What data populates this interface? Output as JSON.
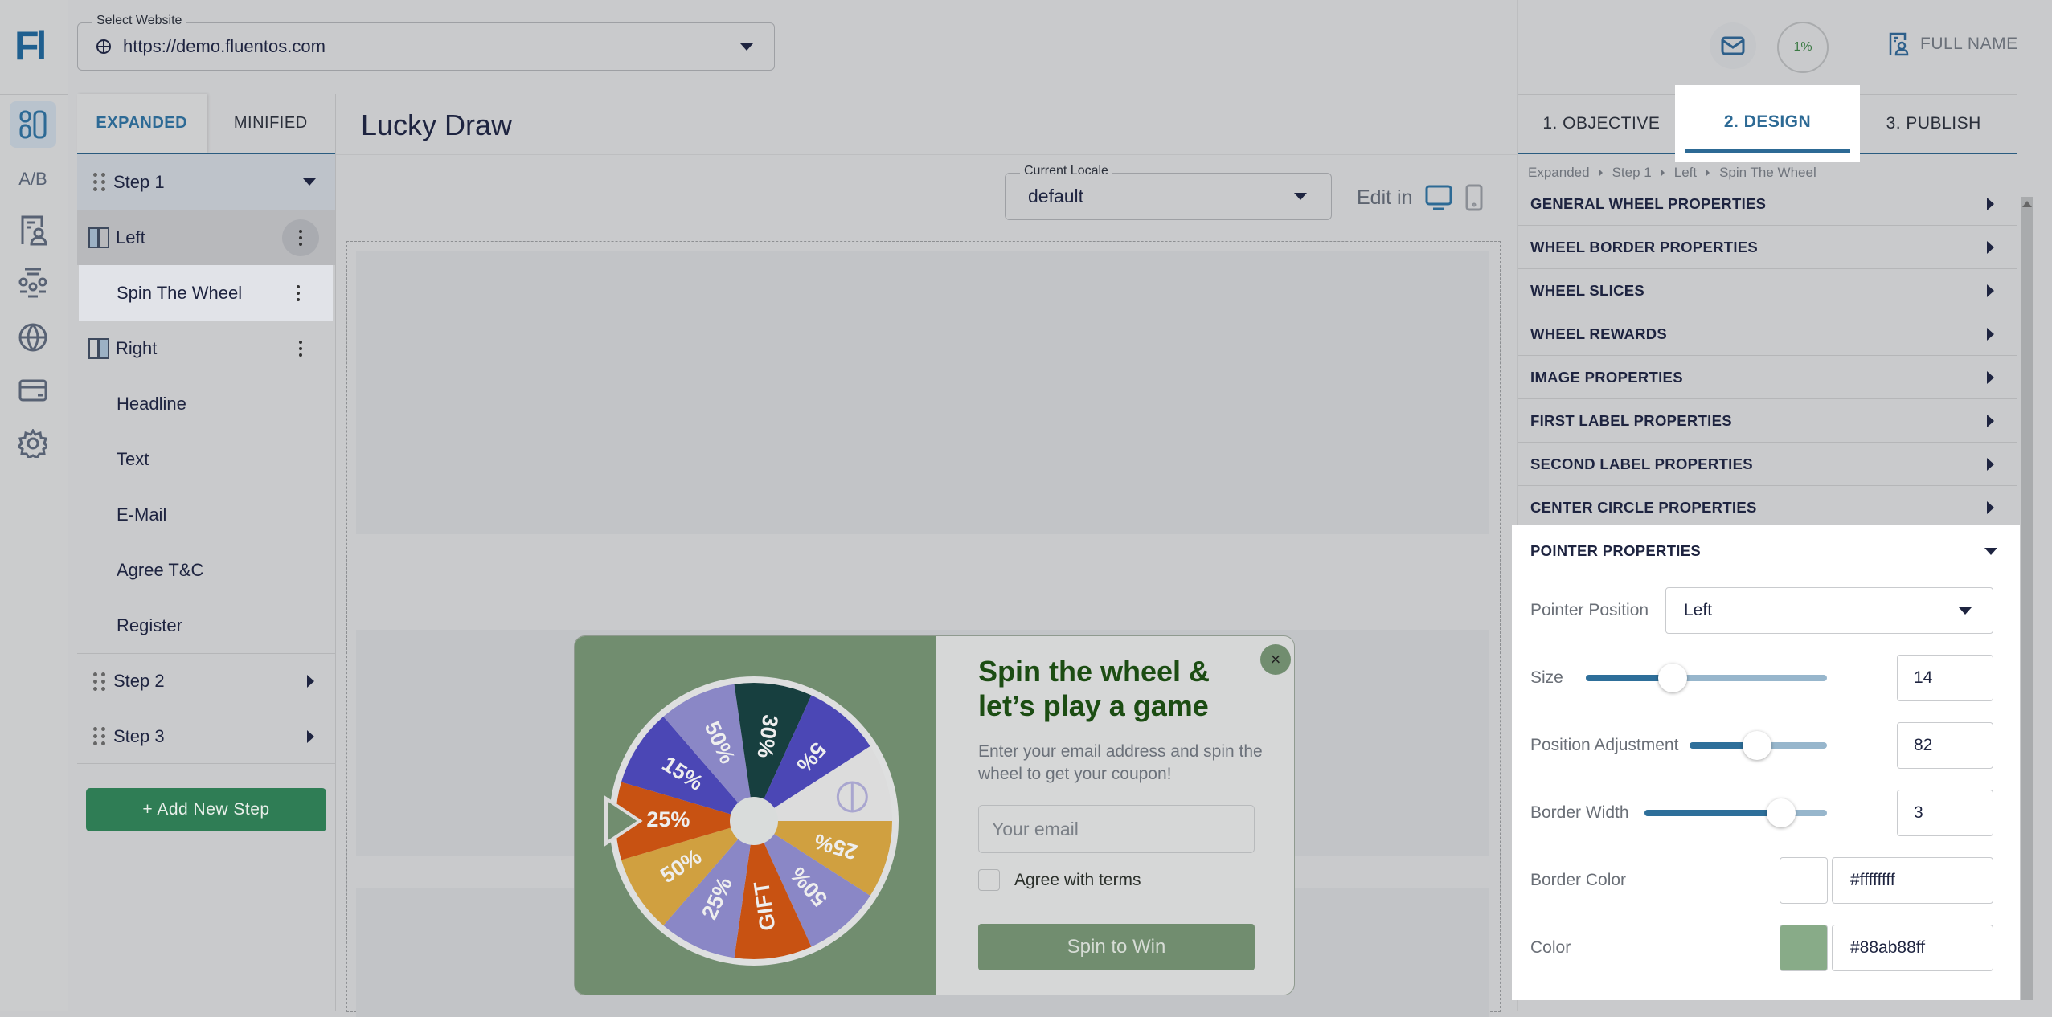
{
  "rail": {
    "logo": "Fl",
    "ab_label": "A/B",
    "items": [
      "layout-icon",
      "ab-test-icon",
      "contact-form-icon",
      "audience-icon",
      "globe-icon",
      "billing-icon",
      "settings-icon"
    ]
  },
  "topbar": {
    "website_label": "Select Website",
    "website_value": "https://demo.fluentos.com"
  },
  "left_panel": {
    "tabs": [
      {
        "label": "EXPANDED",
        "active": true
      },
      {
        "label": "MINIFIED",
        "active": false
      }
    ],
    "tree": {
      "step1": "Step 1",
      "left": "Left",
      "spin": "Spin The Wheel",
      "right": "Right",
      "headline": "Headline",
      "text": "Text",
      "email": "E-Mail",
      "agree": "Agree T&C",
      "register": "Register",
      "step2": "Step 2",
      "step3": "Step 3"
    },
    "add_step": "+ Add New Step"
  },
  "main": {
    "title": "Lucky Draw",
    "locale_label": "Current Locale",
    "locale_value": "default",
    "edit_in": "Edit in"
  },
  "popup": {
    "headline": "Spin the wheel & let’s play a game",
    "text": "Enter your email address and spin the wheel to get your coupon!",
    "email_placeholder": "Your email",
    "agree": "Agree with terms",
    "button": "Spin to Win",
    "close": "×",
    "wheel": {
      "pointer_color": "#88ab88",
      "slices": [
        {
          "label": "25%",
          "color": "#d0a040"
        },
        {
          "label": "50%",
          "color": "#8a87c6"
        },
        {
          "label": "GIFT",
          "color": "#c85212"
        },
        {
          "label": "25%",
          "color": "#8a87c6"
        },
        {
          "label": "50%",
          "color": "#d0a040"
        },
        {
          "label": "25%",
          "color": "#c85212"
        },
        {
          "label": "15%",
          "color": "#4b47b5"
        },
        {
          "label": "50%",
          "color": "#8a87c6"
        },
        {
          "label": "30%",
          "color": "#173f3f"
        },
        {
          "label": "5%",
          "color": "#4b47b5"
        },
        {
          "label": "",
          "color": "#dcdcdc",
          "icon": "no-entry-icon"
        }
      ]
    }
  },
  "right_panel": {
    "progress": "1%",
    "user": "FULL NAME",
    "tabs": [
      {
        "label": "1. OBJECTIVE"
      },
      {
        "label": "2. DESIGN",
        "active": true
      },
      {
        "label": "3. PUBLISH"
      }
    ],
    "breadcrumb": [
      "Expanded",
      "Step 1",
      "Left",
      "Spin The Wheel"
    ],
    "sections": [
      "GENERAL WHEEL PROPERTIES",
      "WHEEL BORDER PROPERTIES",
      "WHEEL SLICES",
      "WHEEL REWARDS",
      "IMAGE PROPERTIES",
      "FIRST LABEL PROPERTIES",
      "SECOND LABEL PROPERTIES",
      "CENTER CIRCLE PROPERTIES"
    ],
    "pointer": {
      "title": "POINTER PROPERTIES",
      "position_label": "Pointer Position",
      "position_value": "Left",
      "size_label": "Size",
      "size_value": "14",
      "size_fraction": 0.36,
      "adj_label": "Position Adjustment",
      "adj_value": "82",
      "adj_fraction": 0.49,
      "bw_label": "Border Width",
      "bw_value": "3",
      "bw_fraction": 0.75,
      "border_color_label": "Border Color",
      "border_color_value": "#ffffffff",
      "border_color": "#ffffff",
      "color_label": "Color",
      "color_value": "#88ab88ff",
      "color": "#88ab88"
    }
  }
}
